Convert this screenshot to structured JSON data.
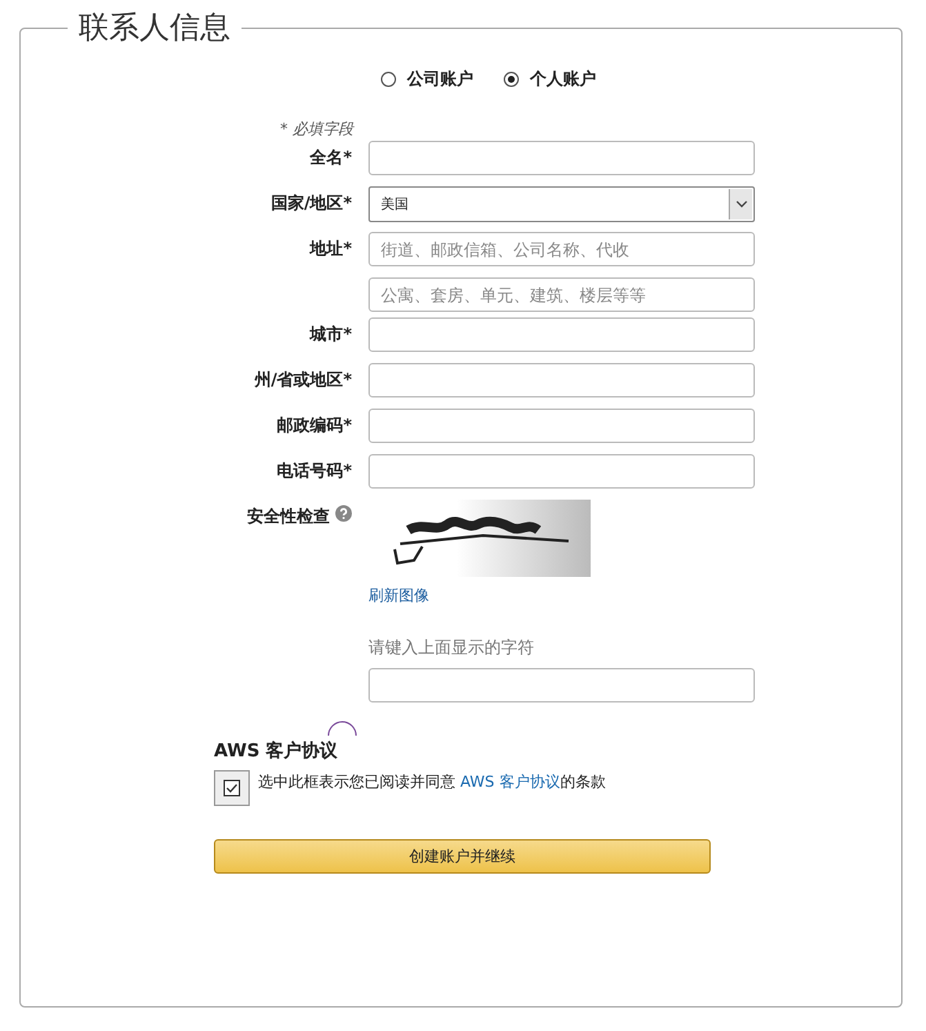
{
  "section": {
    "title": "联系人信息"
  },
  "account_type": [
    {
      "label": "公司账户",
      "selected": false
    },
    {
      "label": "个人账户",
      "selected": true
    }
  ],
  "required_note": "* 必填字段",
  "fields": [
    {
      "kind": "text",
      "label": "全名*"
    },
    {
      "kind": "select",
      "label": "国家/地区*",
      "value": "美国"
    },
    {
      "kind": "text",
      "label": "地址*",
      "placeholder": "街道、邮政信箱、公司名称、代收"
    },
    {
      "kind": "text",
      "placeholder": "公寓、套房、单元、建筑、楼层等等"
    },
    {
      "kind": "text",
      "label": "城市*"
    },
    {
      "kind": "text",
      "label": "州/省或地区*"
    },
    {
      "kind": "text",
      "label": "邮政编码*"
    },
    {
      "kind": "text",
      "label": "电话号码*"
    }
  ],
  "security_check": {
    "label": "安全性检查",
    "refresh_link": "刷新图像",
    "prompt": "请键入上面显示的字符"
  },
  "agreement": {
    "title": "AWS 客户协议",
    "checked": true,
    "text": "选中此框表示您已阅读并同意 ",
    "link": "AWS 客户协议",
    "text_after": "的条款"
  },
  "submit_button": "创建账户并继续"
}
